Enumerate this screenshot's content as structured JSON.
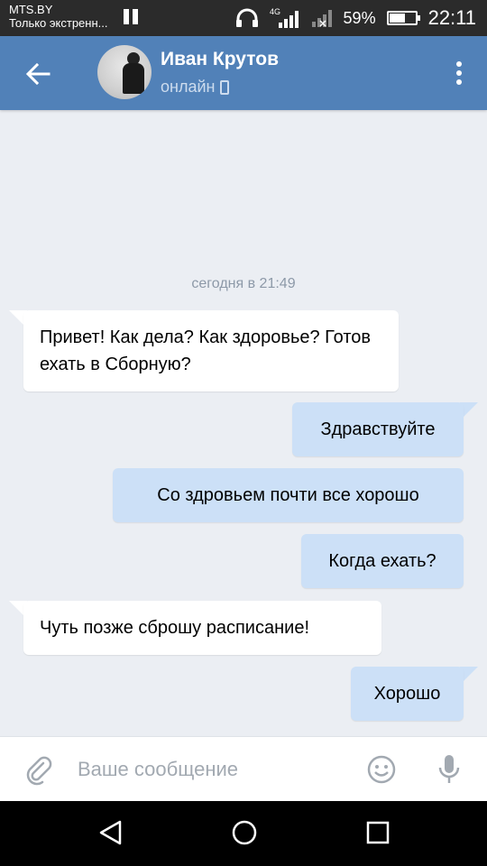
{
  "status_bar": {
    "carrier": "MTS.BY",
    "carrier_sub": "Только экстренн...",
    "battery": "59%",
    "time": "22:11",
    "network": "4G"
  },
  "header": {
    "name": "Иван Крутов",
    "status": "онлайн"
  },
  "chat": {
    "date_separator": "сегодня в 21:49",
    "messages": [
      {
        "dir": "in",
        "text": "Привет! Как дела? Как здоровье? Готов ехать в Сборную?"
      },
      {
        "dir": "out",
        "text": "Здравствуйте"
      },
      {
        "dir": "out",
        "text": "Со здровьем почти все хорошо"
      },
      {
        "dir": "out",
        "text": "Когда ехать?"
      },
      {
        "dir": "in",
        "text": "Чуть позже сброшу расписание!"
      },
      {
        "dir": "out",
        "text": "Хорошо"
      }
    ]
  },
  "input": {
    "placeholder": "Ваше сообщение"
  },
  "colors": {
    "header_bg": "#5181b8",
    "chat_bg": "#ebeef3",
    "incoming_bubble": "#ffffff",
    "outgoing_bubble": "#cce0f7"
  }
}
